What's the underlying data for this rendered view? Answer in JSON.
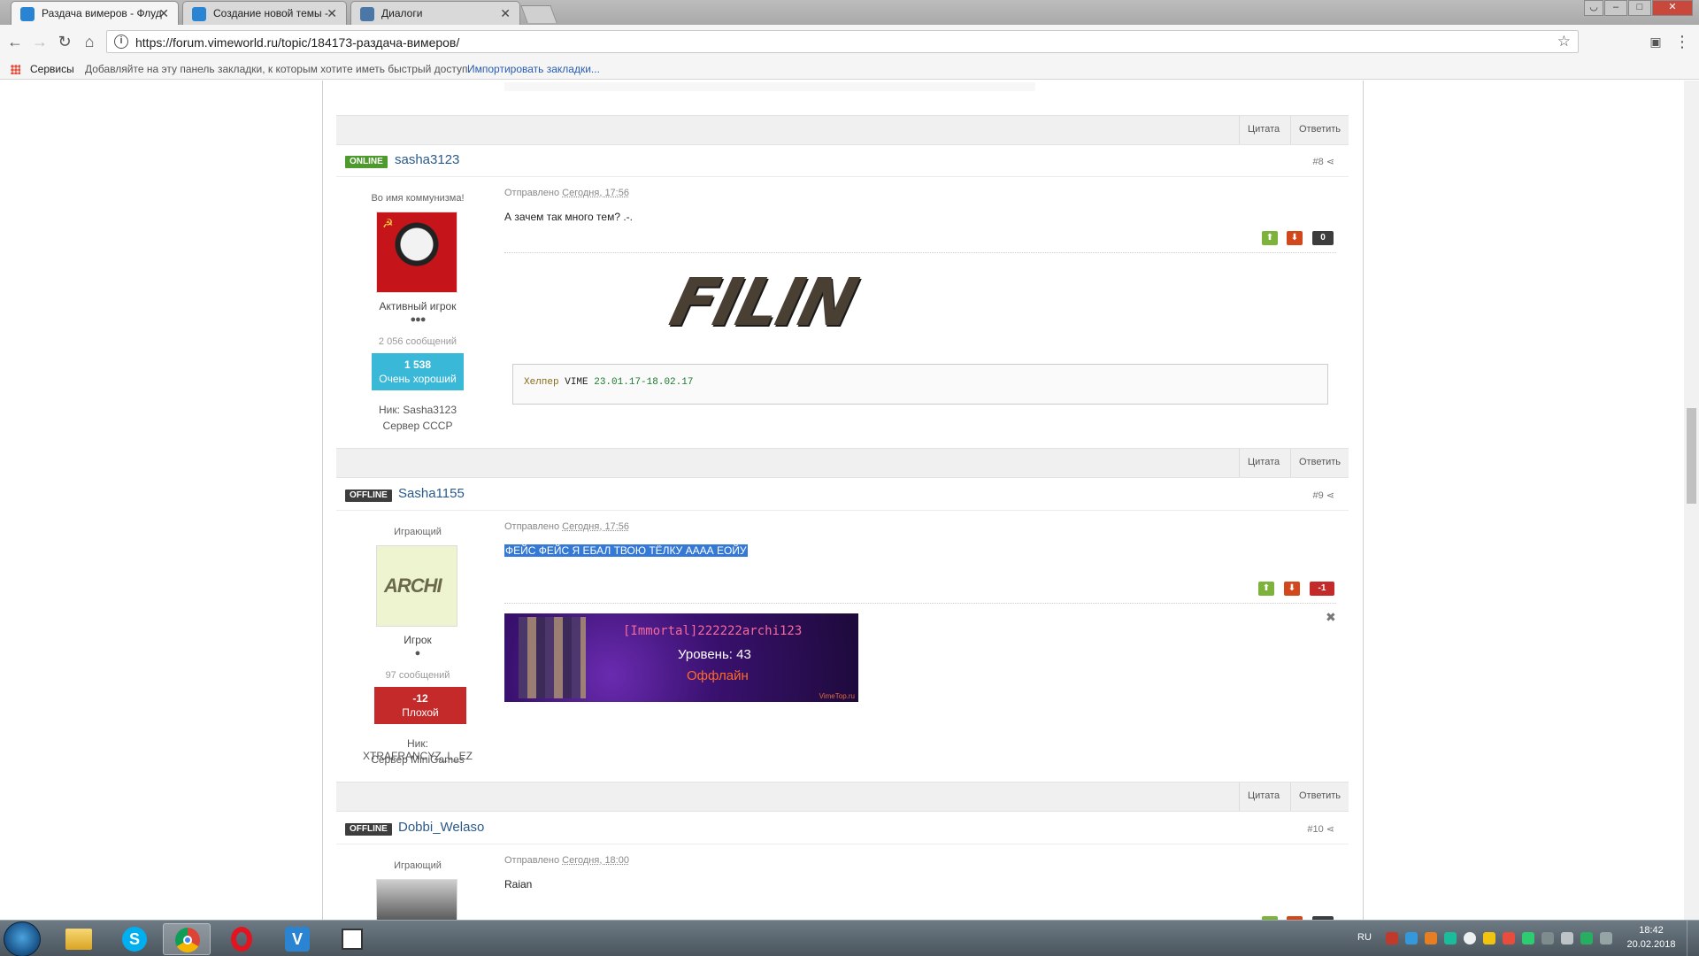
{
  "browser": {
    "tabs": [
      {
        "title": "Раздача вимеров - Флуд",
        "active": true
      },
      {
        "title": "Создание новой темы - ",
        "active": false
      },
      {
        "title": "Диалоги",
        "active": false
      }
    ],
    "url": "https://forum.vimeworld.ru/topic/184173-раздача-вимеров/",
    "bookmarks": {
      "apps_label": "Сервисы",
      "hint": "Добавляйте на эту панель закладки, к которым хотите иметь быстрый доступ.",
      "import_link": "Импортировать закладки..."
    }
  },
  "actions": {
    "quote": "Цитата",
    "reply": "Ответить"
  },
  "posts": [
    {
      "status": "ONLINE",
      "username": "sasha3123",
      "number": "#8",
      "title": "Во имя коммунизма!",
      "rank": "Активный игрок",
      "pips": "●●●",
      "messages": "2 056 сообщений",
      "rep_value": "1 538",
      "rep_label": "Очень хороший",
      "nick": "Ник: Sasha3123",
      "server": "Сервер СССР",
      "posted_label": "Отправлено",
      "posted_time": "Сегодня, 17:56",
      "text": "А зачем так много тем? .-.",
      "score": "0",
      "signature_logo": "FILIN",
      "code": {
        "word1": "Хелпер",
        "word2": "VIME",
        "dates": "23.01.17-18.02.17"
      }
    },
    {
      "status": "OFFLINE",
      "username": "Sasha1155",
      "number": "#9",
      "title": "Играющий",
      "avatar_text": "ARCHI",
      "rank": "Игрок",
      "pips": "●",
      "messages": "97 сообщений",
      "rep_value": "-12",
      "rep_label": "Плохой",
      "nick": "Ник: XTRAFRANCYZ_L_EZ",
      "server": "Сервер MiniGames",
      "posted_label": "Отправлено",
      "posted_time": "Сегодня, 17:56",
      "text": "ФЕЙС ФЕЙС Я ЕБАЛ ТВОЮ ТЁЛКУ АААА ЕОЙУ",
      "score": "-1",
      "banner": {
        "line1": "[Immortal]222222archi123",
        "line2": "Уровень: 43",
        "line3": "Оффлайн",
        "site": "VimeTop.ru"
      }
    },
    {
      "status": "OFFLINE",
      "username": "Dobbi_Welaso",
      "number": "#10",
      "title": "Играющий",
      "posted_label": "Отправлено",
      "posted_time": "Сегодня, 18:00",
      "text": "Raian"
    }
  ],
  "taskbar": {
    "lang": "RU",
    "time": "18:42",
    "date": "20.02.2018"
  }
}
